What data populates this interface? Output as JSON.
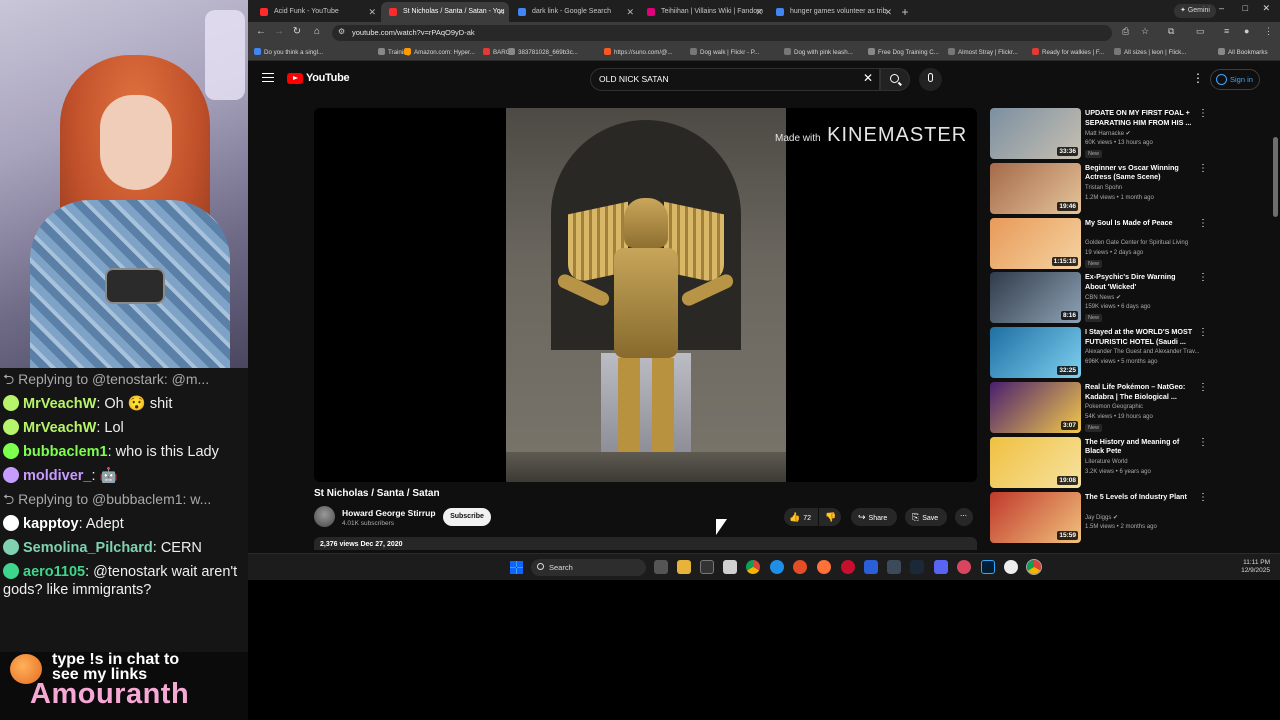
{
  "chat": [
    {
      "type": "reply",
      "text": "Replying to @tenostark: @m..."
    },
    {
      "user": "MrVeachW",
      "color": "#b7f36b",
      "text": "Oh 😯 shit"
    },
    {
      "user": "MrVeachW",
      "color": "#b7f36b",
      "text": "Lol"
    },
    {
      "user": "bubbaclem1",
      "color": "#7cff4d",
      "text": "who is this Lady"
    },
    {
      "user": "moldiver_",
      "color": "#c79cff",
      "text": "🤖"
    },
    {
      "type": "reply",
      "text": "Replying to @bubbaclem1: w..."
    },
    {
      "user": "kapptoy",
      "color": "#ffffff",
      "text": "Adept"
    },
    {
      "user": "Semolina_Pilchard",
      "color": "#7fd1b0",
      "text": "CERN"
    },
    {
      "user": "aero1105",
      "color": "#3dd68c",
      "text": "@tenostark wait aren't gods? like immigrants?"
    }
  ],
  "promo": {
    "line": "type !s in chat to see my links",
    "brand": "Amouranth"
  },
  "browser": {
    "tabs": [
      {
        "label": "Acid Funk - YouTube",
        "color": "#ff2a2a"
      },
      {
        "label": "St Nicholas / Santa / Satan - You",
        "color": "#ff2a2a",
        "active": true
      },
      {
        "label": "dark link - Google Search",
        "color": "#4285f4"
      },
      {
        "label": "Teihiihan | Villains Wiki | Fandom",
        "color": "#e3007a"
      },
      {
        "label": "hunger games volunteer as trib",
        "color": "#4285f4"
      }
    ],
    "gemini_label": "Gemini",
    "url": "youtube.com/watch?v=rPAqO9yD-ak",
    "bookmarks": [
      "Do you think a singl...",
      "Training",
      "Amazon.com: Hyper...",
      "BARC",
      "383781028_669b3c...",
      "https://suno.com/@...",
      "Dog walk | Flickr - P...",
      "Dog with pink leash...",
      "Free Dog Training C...",
      "Almost Stray | Flickr...",
      "Ready for walkies | F...",
      "All sizes | leon | Flick...",
      "All Bookmarks"
    ]
  },
  "youtube": {
    "logo_text": "YouTube",
    "search_query": "OLD NICK SATAN",
    "signin_label": "Sign in",
    "watermark_small": "Made with",
    "watermark_big": "KINEMASTER",
    "video_title": "St Nicholas / Santa / Satan",
    "channel": "Howard George Stirrup",
    "subs": "4.01K subscribers",
    "subscribe_label": "Subscribe",
    "likes": "72",
    "share_label": "Share",
    "save_label": "Save",
    "desc_meta": "2,376 views  Dec 27, 2020",
    "sidebar": [
      {
        "title": "UPDATE ON MY FIRST FOAL + SEPARATING HIM FROM HIS ...",
        "channel": "Matt Harnacke ✔",
        "meta": "60K views • 13 hours ago",
        "new": "New",
        "dur": "33:36",
        "c1": "#7b8fa0",
        "c2": "#c7c0b2"
      },
      {
        "title": "Beginner vs Oscar Winning Actress (Same Scene)",
        "channel": "Tristan Spohn",
        "meta": "1.2M views • 1 month ago",
        "dur": "19:46",
        "c1": "#a56a4a",
        "c2": "#e5c49a"
      },
      {
        "title": "My Soul Is Made of Peace",
        "channel": "Golden Gate Center for Spiritual Living",
        "meta": "19 views • 2 days ago",
        "new": "New",
        "dur": "1:15:18",
        "c1": "#e89a5a",
        "c2": "#f4d3a0"
      },
      {
        "title": "Ex-Psychic's Dire Warning About 'Wicked'",
        "channel": "CBN News ✔",
        "meta": "159K views • 6 days ago",
        "new": "New",
        "dur": "8:16",
        "c1": "#2f3b4a",
        "c2": "#8fa2b5"
      },
      {
        "title": "I Stayed at the WORLD'S MOST FUTURISTIC HOTEL (Saudi ...",
        "channel": "Alexander The Guest and Alexander Trav...",
        "meta": "696K views • 5 months ago",
        "dur": "32:25",
        "c1": "#1e6fa3",
        "c2": "#7fd0ef"
      },
      {
        "title": "Real Life Pokémon – NatGeo: Kadabra | The Biological ...",
        "channel": "Pokemon Geographic",
        "meta": "54K views • 19 hours ago",
        "new": "New",
        "dur": "3:07",
        "c1": "#4a1f6e",
        "c2": "#f2c94c"
      },
      {
        "title": "The History and Meaning of Black Pete",
        "channel": "Literature World",
        "meta": "3.2K views • 6 years ago",
        "dur": "19:08",
        "c1": "#f0c040",
        "c2": "#f6e3a0"
      },
      {
        "title": "The 5 Levels of Industry Plant",
        "channel": "Jay Diggs ✔",
        "meta": "1.5M views • 2 months ago",
        "dur": "15:59",
        "c1": "#c0392b",
        "c2": "#f1c27d"
      }
    ]
  },
  "taskbar": {
    "search_label": "Search",
    "time": "11:11 PM",
    "date": "12/9/2025"
  }
}
